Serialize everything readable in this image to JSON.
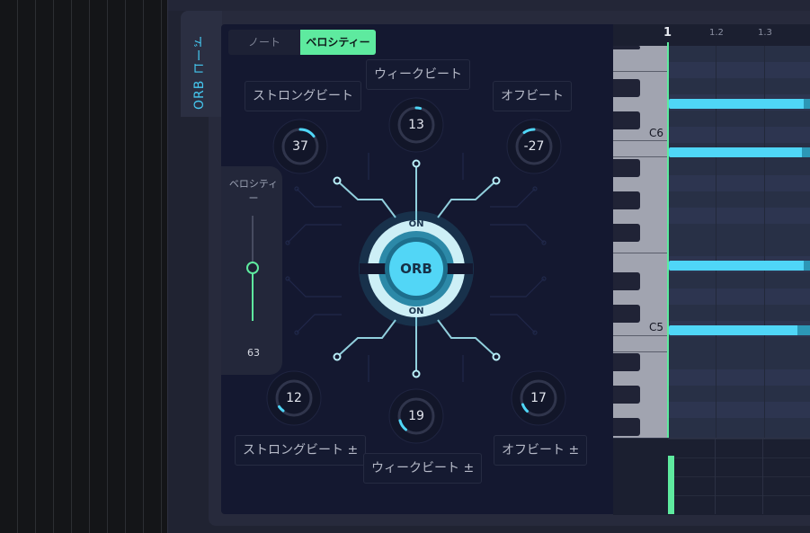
{
  "side_tab": {
    "title": "ORB コード"
  },
  "tabs": [
    {
      "label": "ノート",
      "active": false
    },
    {
      "label": "ベロシティー",
      "active": true
    }
  ],
  "knobs": {
    "strong_beat": {
      "label": "ストロングビート",
      "value": "37"
    },
    "weak_beat": {
      "label": "ウィークビート",
      "value": "13"
    },
    "off_beat": {
      "label": "オフビート",
      "value": "-27"
    },
    "strong_beat_range": {
      "label": "ストロングビート ±",
      "value": "12"
    },
    "weak_beat_range": {
      "label": "ウィークビート ±",
      "value": "19"
    },
    "off_beat_range": {
      "label": "オフビート ±",
      "value": "17"
    }
  },
  "velocity_slider": {
    "label": "ベロシティー",
    "value": "63",
    "level": 0.5
  },
  "orb": {
    "center_label": "ORB",
    "top_toggle": "ON",
    "bottom_toggle": "ON"
  },
  "piano_roll": {
    "ruler": {
      "bar": "1",
      "beat2": "1.2",
      "beat3": "1.3"
    },
    "key_labels": {
      "c6": "C6",
      "c5": "C5"
    }
  },
  "colors": {
    "accent_green": "#5eea9f",
    "accent_cyan": "#4fd6f7",
    "panel_bg": "#141830"
  }
}
